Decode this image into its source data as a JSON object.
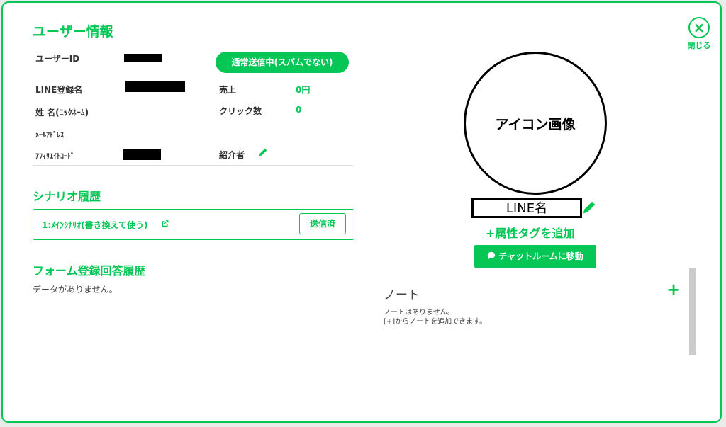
{
  "modal": {
    "title": "ユーザー情報",
    "close_label": "閉じる",
    "close_glyph": "×"
  },
  "user": {
    "user_id_label": "ユーザーID",
    "line_name_label": "LINE登録名",
    "name_label": "姓 名(ﾆｯｸﾈｰﾑ)",
    "email_label": "ﾒｰﾙｱﾄﾞﾚｽ",
    "affiliate_label": "ｱﾌｨﾘｴｲﾄｺｰﾄﾞ",
    "status_button": "通常送信中(スパムでない)",
    "sales_label": "売上",
    "sales_value": "0円",
    "clicks_label": "クリック数",
    "clicks_value": "0",
    "referrer_label": "紹介者"
  },
  "scenario": {
    "heading": "シナリオ履歴",
    "item_label": "1:ﾒｲﾝｼﾅﾘｵ(書き換えて使う)",
    "sent_button": "送信済"
  },
  "form_history": {
    "heading": "フォーム登録回答履歴",
    "empty_text": "データがありません。"
  },
  "profile": {
    "icon_placeholder": "アイコン画像",
    "line_name": "LINE名",
    "add_tag": "属性タグを追加",
    "chat_button": "チャットルームに移動"
  },
  "notes": {
    "title": "ノート",
    "empty_line1": "ノートはありません。",
    "empty_line2": "[+]からノートを追加できます。"
  },
  "colors": {
    "accent": "#06c755"
  }
}
